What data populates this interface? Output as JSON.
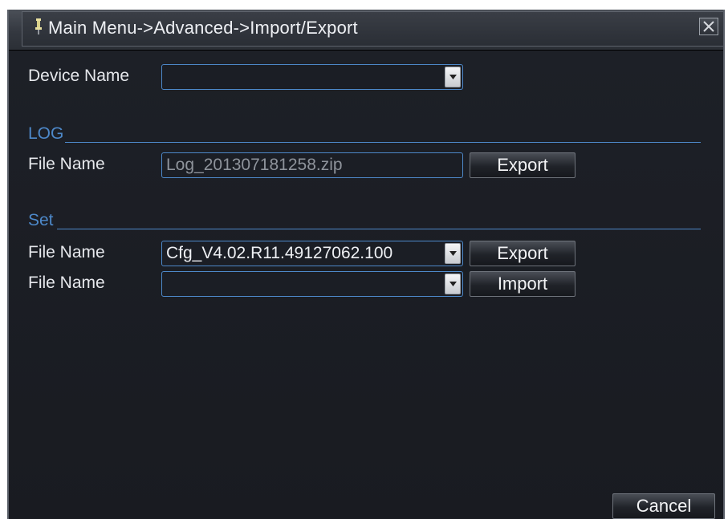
{
  "window": {
    "title": "Main Menu->Advanced->Import/Export",
    "title_icon": "pin-icon",
    "close_icon": "close-icon"
  },
  "device": {
    "label": "Device Name",
    "value": ""
  },
  "log": {
    "section_title": "LOG",
    "file_label": "File Name",
    "file_value": "Log_201307181258.zip",
    "export_label": "Export"
  },
  "set": {
    "section_title": "Set",
    "export_file_label": "File Name",
    "export_file_value": "Cfg_V4.02.R11.49127062.100",
    "export_label": "Export",
    "import_file_label": "File Name",
    "import_file_value": "",
    "import_label": "Import"
  },
  "footer": {
    "cancel_label": "Cancel"
  },
  "colors": {
    "accent": "#4d88c9",
    "background": "#1b1e25",
    "text": "#e6e8ec",
    "disabled_text": "#8e939b"
  }
}
